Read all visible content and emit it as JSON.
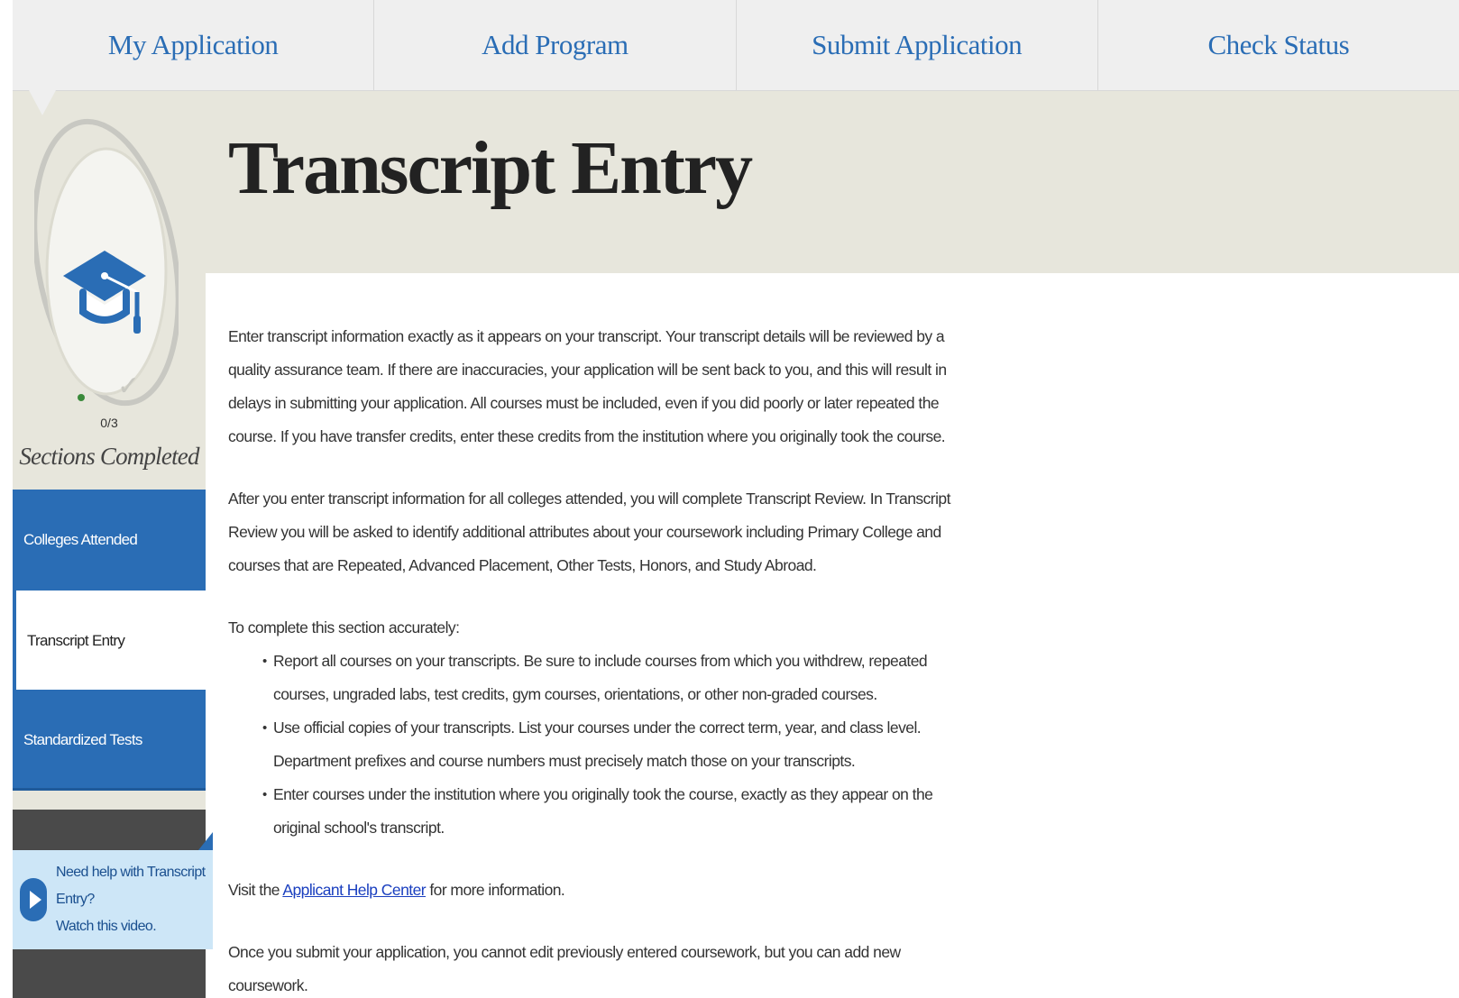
{
  "topnav": {
    "items": [
      "My Application",
      "Add Program",
      "Submit Application",
      "Check Status"
    ]
  },
  "sidebar": {
    "progress": {
      "completed": 0,
      "total": 3,
      "count_text": "0/3",
      "label": "Sections Completed"
    },
    "items": [
      {
        "label": "Colleges Attended",
        "state": "default"
      },
      {
        "label": "Transcript Entry",
        "state": "active"
      },
      {
        "label": "Standardized Tests",
        "state": "default"
      }
    ],
    "help": {
      "line1": "Need help with Transcript",
      "line2": "Entry?",
      "line3": "Watch this video."
    }
  },
  "page": {
    "title": "Transcript Entry",
    "para1": "Enter transcript information exactly as it appears on your transcript. Your transcript details will be reviewed by a quality assurance team. If there are inaccuracies, your application will be sent back to you, and this will result in delays in submitting your application. All courses must be included, even if you did poorly or later repeated the course. If you have transfer credits, enter these credits from the institution where you originally took the course.",
    "para2": "After you enter transcript information for all colleges attended, you will complete Transcript Review. In Transcript Review you will be asked to identify additional attributes about your coursework including Primary College and courses that are Repeated, Advanced Placement, Other Tests, Honors, and Study Abroad.",
    "list_intro": "To complete this section accurately:",
    "bullets": [
      "Report all courses on your transcripts. Be sure to include courses from which you withdrew, repeated courses, ungraded labs, test credits, gym courses, orientations, or other non-graded courses.",
      "Use official copies of your transcripts. List your courses under the correct term, year, and class level. Department prefixes and course numbers must precisely match those on your transcripts.",
      "Enter courses under the institution where you originally took the course, exactly as they appear on the original school's transcript."
    ],
    "visit_prefix": "Visit the ",
    "visit_link": "Applicant Help Center",
    "visit_suffix": " for more information.",
    "para_last": "Once you submit your application, you cannot edit previously entered coursework, but you can add new coursework."
  },
  "colors": {
    "accent_blue": "#2a6db5",
    "beige": "#e7e6dc",
    "help_bg": "#cde6f7",
    "progress_dot": "#3a8a3a"
  }
}
